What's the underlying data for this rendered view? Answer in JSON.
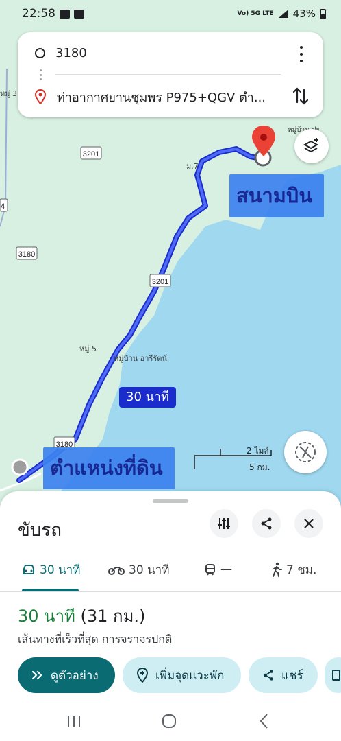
{
  "status_bar": {
    "time": "22:58",
    "network_label": "Vo) 5G LTE",
    "battery": "43%",
    "icons": [
      "gallery-icon",
      "youtube-icon",
      "wifi-calling-icon",
      "signal-icon",
      "battery-icon"
    ]
  },
  "directions": {
    "origin": "3180",
    "destination": "ท่าอากาศยานชุมพร P975+QGV ตำ..."
  },
  "map": {
    "road_labels": [
      "3201",
      "3180",
      "3201",
      "3180",
      "4"
    ],
    "place_labels": [
      "ม.7",
      "หมู่บ้าน ปะ",
      "หมู่ 5",
      "หมู่บ้าน อารีรัตน์",
      "หมู่ 3"
    ],
    "route_time": "30 นาที",
    "scale_top": "2 ไมล์",
    "scale_bottom": "5 กม.",
    "colors": {
      "land": "#d7f0e1",
      "sea": "#9fd8ef",
      "route": "#1a2ccb",
      "pin": "#ea4335"
    }
  },
  "overlays": {
    "airport": "สนามบิน",
    "land_position": "ตำแหน่งที่ดิน"
  },
  "sheet": {
    "title": "ขับรถ",
    "modes": [
      {
        "name": "car",
        "label": "30 นาที"
      },
      {
        "name": "motorcycle",
        "label": "30 นาที"
      },
      {
        "name": "transit",
        "label": "—"
      },
      {
        "name": "walk",
        "label": "7 ชม."
      }
    ],
    "duration": "30 นาที",
    "distance": "(31 กม.)",
    "route_description": "เส้นทางที่เร็วที่สุด การจราจรปกติ",
    "actions": {
      "preview": "ดูตัวอย่าง",
      "add_stop": "เพิ่มจุดแวะพัก",
      "share": "แชร์"
    }
  }
}
